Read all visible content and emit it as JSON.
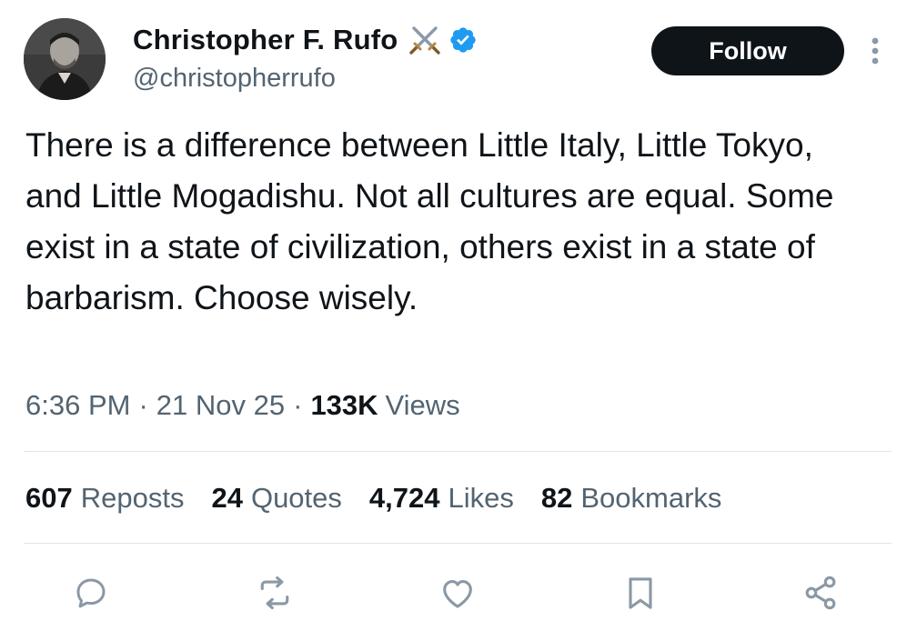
{
  "author": {
    "display_name": "Christopher F. Rufo",
    "handle": "@christopherrufo",
    "badges": [
      "crossed-swords-icon",
      "verified-badge-icon"
    ]
  },
  "follow_button": {
    "label": "Follow"
  },
  "more_icon": "more-vertical-icon",
  "tweet": {
    "text": "There is a difference between Little Italy, Little Tokyo, and Little Mogadishu. Not all cultures are equal. Some exist in a state of civilization, others exist in a state of barbarism. Choose wisely."
  },
  "meta": {
    "time": "6:36 PM",
    "separator": "·",
    "date": "21 Nov 25",
    "views_count": "133K",
    "views_label": "Views"
  },
  "stats": [
    {
      "count": "607",
      "label": "Reposts"
    },
    {
      "count": "24",
      "label": "Quotes"
    },
    {
      "count": "4,724",
      "label": "Likes"
    },
    {
      "count": "82",
      "label": "Bookmarks"
    }
  ],
  "actions": [
    "reply-icon",
    "repost-icon",
    "like-icon",
    "bookmark-icon",
    "share-icon"
  ],
  "colors": {
    "primary_text": "#0f1419",
    "secondary_text": "#536471",
    "verified_blue": "#1d9bf0",
    "follow_button_bg": "#0f1419",
    "divider": "#dfe4e8",
    "icon_gray": "#8b98a5"
  }
}
